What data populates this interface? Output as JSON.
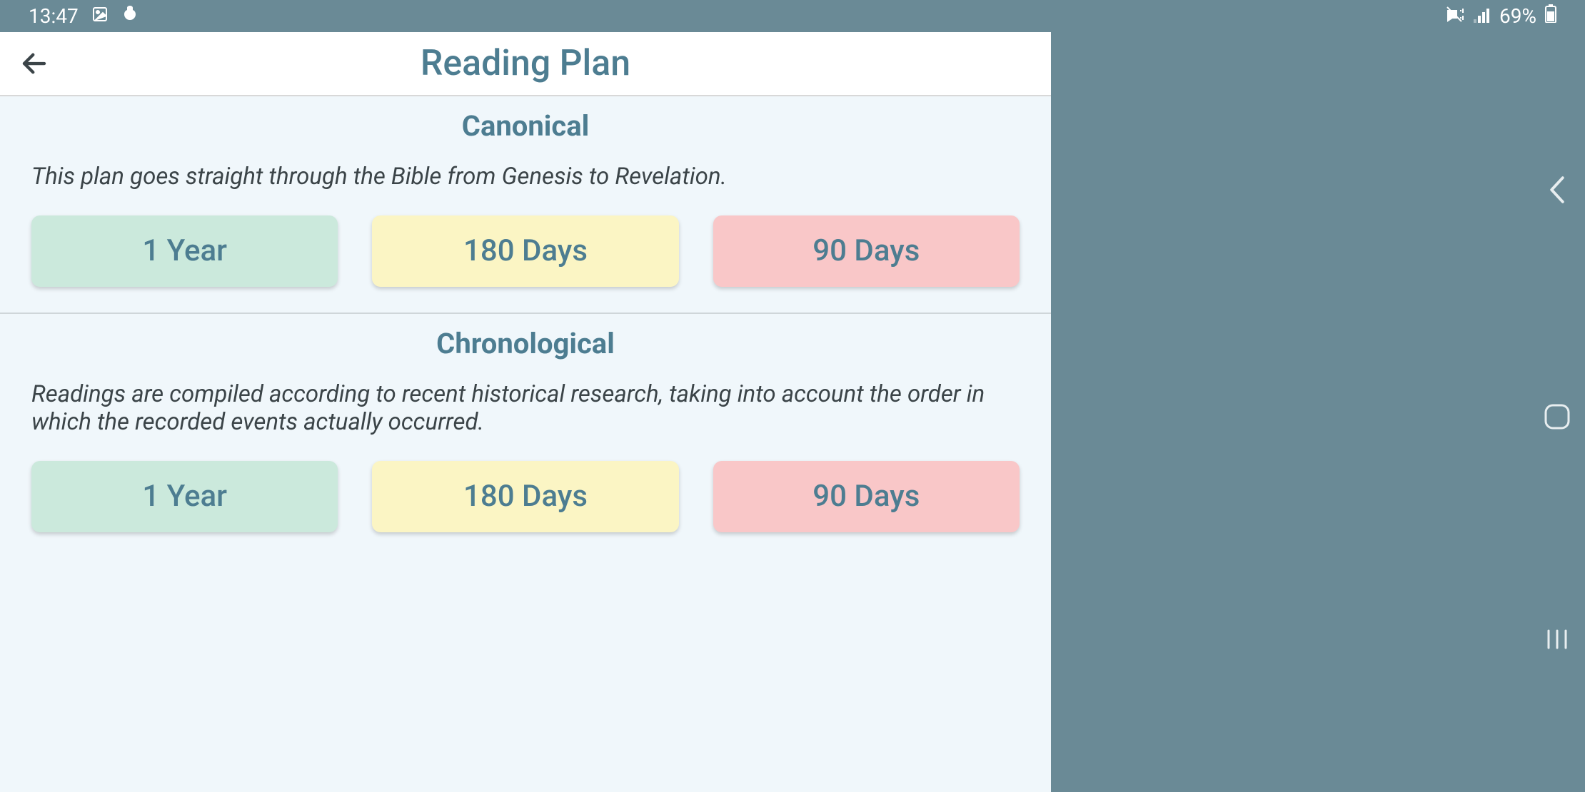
{
  "status": {
    "time": "13:47",
    "battery": "69%"
  },
  "header": {
    "title": "Reading Plan"
  },
  "sections": [
    {
      "title": "Canonical",
      "desc": "This plan goes straight through the Bible from Genesis to Revelation.",
      "options": [
        "1 Year",
        "180 Days",
        "90 Days"
      ]
    },
    {
      "title": "Chronological",
      "desc": "Readings are compiled according to recent historical research, taking into account the order in which the recorded events actually occurred.",
      "options": [
        "1 Year",
        "180 Days",
        "90 Days"
      ]
    }
  ]
}
